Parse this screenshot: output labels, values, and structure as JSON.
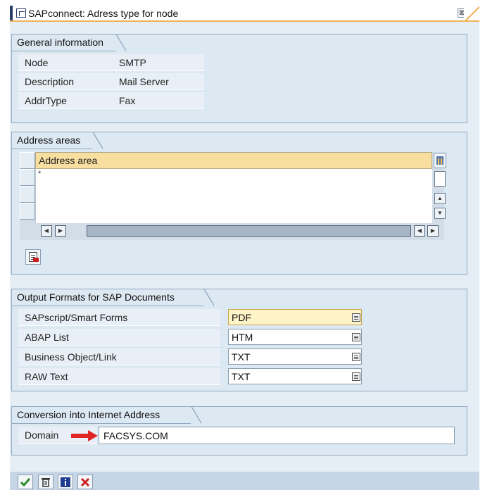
{
  "window": {
    "title": "SAPconnect: Adress type for node",
    "close_glyph": "⊠"
  },
  "general": {
    "tab": "General information",
    "rows": [
      {
        "label": "Node",
        "value": "SMTP"
      },
      {
        "label": "Description",
        "value": "Mail Server"
      },
      {
        "label": "AddrType",
        "value": "Fax"
      }
    ]
  },
  "address_areas": {
    "tab": "Address areas",
    "column_header": "Address area",
    "rows": [
      "*",
      "",
      ""
    ]
  },
  "output_formats": {
    "tab": "Output Formats for SAP Documents",
    "rows": [
      {
        "label": "SAPscript/Smart Forms",
        "value": "PDF"
      },
      {
        "label": "ABAP List",
        "value": "HTM"
      },
      {
        "label": "Business Object/Link",
        "value": "TXT"
      },
      {
        "label": "RAW Text",
        "value": "TXT"
      }
    ]
  },
  "conversion": {
    "tab": "Conversion into Internet Address",
    "domain_label": "Domain",
    "domain_value": "FACSYS.COM"
  },
  "colors": {
    "accent_orange": "#f0b25a",
    "group_bg": "#dce8f2",
    "header_yellow": "#f8dfa0",
    "arrow_red": "#e02424",
    "footer_bg": "#c7d6e6"
  },
  "icons": {
    "confirm": "check-icon",
    "delete": "trash-icon",
    "info": "info-icon",
    "cancel": "cancel-icon"
  }
}
